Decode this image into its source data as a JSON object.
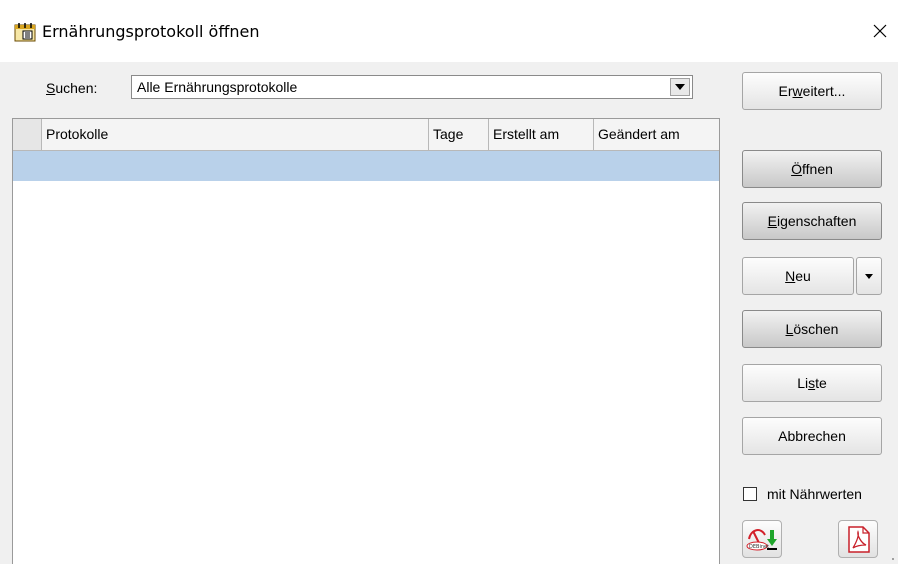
{
  "window": {
    "title": "Ernährungsprotokoll öffnen",
    "icon": "calendar-food-icon",
    "close_symbol": "✕"
  },
  "search": {
    "label_accel": "S",
    "label_rest": "uchen:",
    "selected": "Alle Ernährungsprotokolle"
  },
  "grid": {
    "columns": [
      "Protokolle",
      "Tage",
      "Erstellt am",
      "Geändert am"
    ],
    "rows": []
  },
  "buttons": {
    "erweitert": {
      "pre": "Er",
      "accel": "w",
      "post": "eitert..."
    },
    "oeffnen": {
      "pre": "",
      "accel": "Ö",
      "post": "ffnen"
    },
    "eigenschaften": {
      "pre": "",
      "accel": "E",
      "post": "igenschaften"
    },
    "neu": {
      "pre": "",
      "accel": "N",
      "post": "eu"
    },
    "loeschen": {
      "pre": "",
      "accel": "L",
      "post": "öschen"
    },
    "liste": {
      "pre": "Li",
      "accel": "s",
      "post": "te"
    },
    "abbrechen": {
      "pre": "Abbrechen",
      "accel": "",
      "post": ""
    }
  },
  "checkbox": {
    "label": "mit Nährwerten",
    "checked": false
  },
  "icons": {
    "dge": "dge-export-icon",
    "pdf": "pdf-icon"
  },
  "colors": {
    "selection": "#b9d1ea",
    "background": "#f0f0f0"
  }
}
